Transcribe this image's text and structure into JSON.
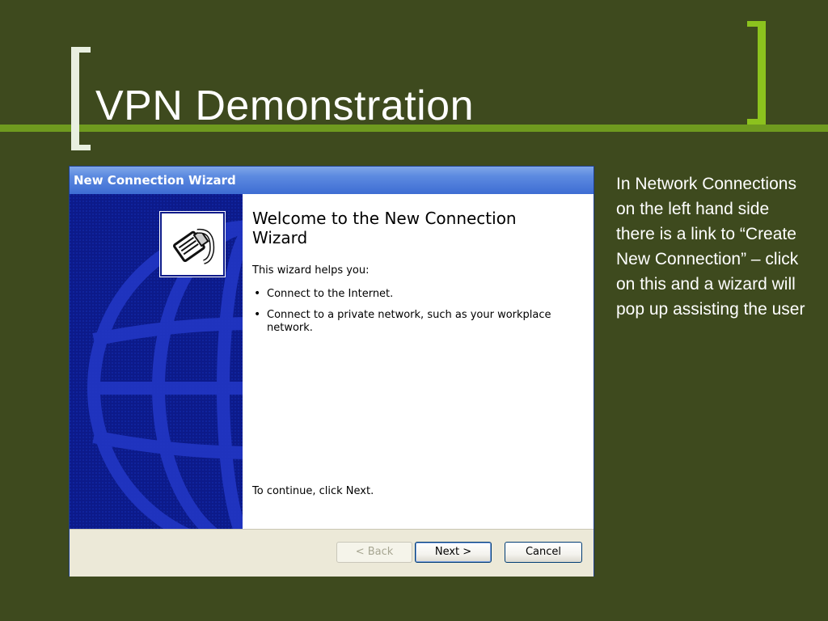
{
  "slide": {
    "title": "VPN Demonstration",
    "side_text": "In Network Connections on the left hand side there is a link to “Create New Connection” – click on this and a wizard will pop up assisting the user"
  },
  "wizard": {
    "window_title": "New Connection Wizard",
    "heading": "Welcome to the New Connection Wizard",
    "intro": "This wizard helps you:",
    "bullets": [
      "Connect to the Internet.",
      "Connect to a private network, such as your workplace network."
    ],
    "continue_text": "To continue, click Next.",
    "buttons": {
      "back": "< Back",
      "next": "Next >",
      "cancel": "Cancel"
    },
    "icon": "network-cable-icon"
  },
  "colors": {
    "background": "#3e4a1e",
    "accent_green": "#8cc21e",
    "titlebar_blue": "#3e6dd3",
    "side_panel_blue": "#0c1a8a"
  }
}
